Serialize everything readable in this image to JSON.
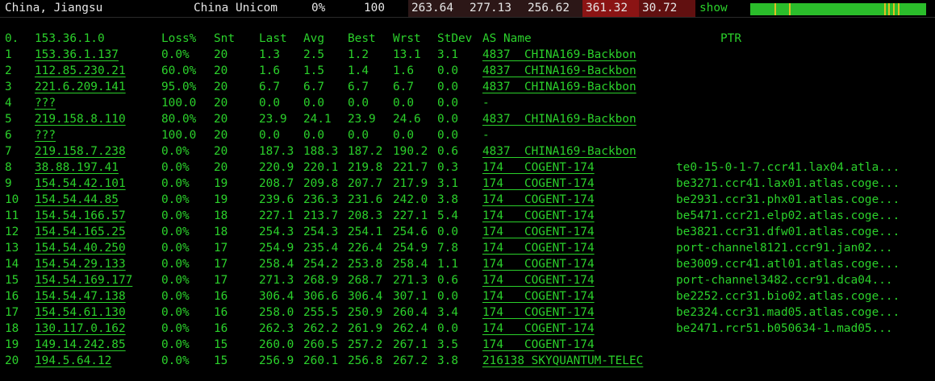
{
  "summary": {
    "location": "China, Jiangsu",
    "isp": "China Unicom",
    "loss": "0%",
    "sent": "100",
    "last": "263.64",
    "avg": "277.13",
    "best": "256.62",
    "worst": "361.32",
    "stdev": "30.72",
    "show_label": "show",
    "colors": {
      "last_bg": "#2c1717",
      "avg_bg": "#2c1717",
      "best_bg": "#2c1717",
      "worst_bg": "#8b1414",
      "stdev_bg": "#611010",
      "spark": "#2bbd2b",
      "spark_tick": "#e0c020"
    }
  },
  "table": {
    "headers": {
      "hop": "0.",
      "ip": "153.36.1.0",
      "loss": "Loss%",
      "snt": "Snt",
      "last": "Last",
      "avg": "Avg",
      "best": "Best",
      "wrst": "Wrst",
      "stdev": "StDev",
      "as": "AS Name",
      "ptr": "PTR"
    },
    "rows": [
      {
        "hop": "1",
        "ip": "153.36.1.137",
        "loss": "0.0%",
        "snt": "20",
        "last": "1.3",
        "avg": "2.5",
        "best": "1.2",
        "wrst": "13.1",
        "stdev": "3.1",
        "as": "4837  CHINA169-Backbon",
        "ptr": ""
      },
      {
        "hop": "2",
        "ip": "112.85.230.21",
        "loss": "60.0%",
        "snt": "20",
        "last": "1.6",
        "avg": "1.5",
        "best": "1.4",
        "wrst": "1.6",
        "stdev": "0.0",
        "as": "4837  CHINA169-Backbon",
        "ptr": ""
      },
      {
        "hop": "3",
        "ip": "221.6.209.141",
        "loss": "95.0%",
        "snt": "20",
        "last": "6.7",
        "avg": "6.7",
        "best": "6.7",
        "wrst": "6.7",
        "stdev": "0.0",
        "as": "4837  CHINA169-Backbon",
        "ptr": ""
      },
      {
        "hop": "4",
        "ip": "???",
        "loss": "100.0",
        "snt": "20",
        "last": "0.0",
        "avg": "0.0",
        "best": "0.0",
        "wrst": "0.0",
        "stdev": "0.0",
        "as": "-",
        "ptr": ""
      },
      {
        "hop": "5",
        "ip": "219.158.8.110",
        "loss": "80.0%",
        "snt": "20",
        "last": "23.9",
        "avg": "24.1",
        "best": "23.9",
        "wrst": "24.6",
        "stdev": "0.0",
        "as": "4837  CHINA169-Backbon",
        "ptr": ""
      },
      {
        "hop": "6",
        "ip": "???",
        "loss": "100.0",
        "snt": "20",
        "last": "0.0",
        "avg": "0.0",
        "best": "0.0",
        "wrst": "0.0",
        "stdev": "0.0",
        "as": "-",
        "ptr": ""
      },
      {
        "hop": "7",
        "ip": "219.158.7.238",
        "loss": "0.0%",
        "snt": "20",
        "last": "187.3",
        "avg": "188.3",
        "best": "187.2",
        "wrst": "190.2",
        "stdev": "0.6",
        "as": "4837  CHINA169-Backbon",
        "ptr": ""
      },
      {
        "hop": "8",
        "ip": "38.88.197.41",
        "loss": "0.0%",
        "snt": "20",
        "last": "220.9",
        "avg": "220.1",
        "best": "219.8",
        "wrst": "221.7",
        "stdev": "0.3",
        "as": "174   COGENT-174",
        "ptr": "te0-15-0-1-7.ccr41.lax04.atla..."
      },
      {
        "hop": "9",
        "ip": "154.54.42.101",
        "loss": "0.0%",
        "snt": "19",
        "last": "208.7",
        "avg": "209.8",
        "best": "207.7",
        "wrst": "217.9",
        "stdev": "3.1",
        "as": "174   COGENT-174",
        "ptr": "be3271.ccr41.lax01.atlas.coge..."
      },
      {
        "hop": "10",
        "ip": "154.54.44.85",
        "loss": "0.0%",
        "snt": "19",
        "last": "239.6",
        "avg": "236.3",
        "best": "231.6",
        "wrst": "242.0",
        "stdev": "3.8",
        "as": "174   COGENT-174",
        "ptr": "be2931.ccr31.phx01.atlas.coge..."
      },
      {
        "hop": "11",
        "ip": "154.54.166.57",
        "loss": "0.0%",
        "snt": "18",
        "last": "227.1",
        "avg": "213.7",
        "best": "208.3",
        "wrst": "227.1",
        "stdev": "5.4",
        "as": "174   COGENT-174",
        "ptr": "be5471.ccr21.elp02.atlas.coge..."
      },
      {
        "hop": "12",
        "ip": "154.54.165.25",
        "loss": "0.0%",
        "snt": "18",
        "last": "254.3",
        "avg": "254.3",
        "best": "254.1",
        "wrst": "254.6",
        "stdev": "0.0",
        "as": "174   COGENT-174",
        "ptr": "be3821.ccr31.dfw01.atlas.coge..."
      },
      {
        "hop": "13",
        "ip": "154.54.40.250",
        "loss": "0.0%",
        "snt": "17",
        "last": "254.9",
        "avg": "235.4",
        "best": "226.4",
        "wrst": "254.9",
        "stdev": "7.8",
        "as": "174   COGENT-174",
        "ptr": "port-channel8121.ccr91.jan02..."
      },
      {
        "hop": "14",
        "ip": "154.54.29.133",
        "loss": "0.0%",
        "snt": "17",
        "last": "258.4",
        "avg": "254.2",
        "best": "253.8",
        "wrst": "258.4",
        "stdev": "1.1",
        "as": "174   COGENT-174",
        "ptr": "be3009.ccr41.atl01.atlas.coge..."
      },
      {
        "hop": "15",
        "ip": "154.54.169.177",
        "loss": "0.0%",
        "snt": "17",
        "last": "271.3",
        "avg": "268.9",
        "best": "268.7",
        "wrst": "271.3",
        "stdev": "0.6",
        "as": "174   COGENT-174",
        "ptr": "port-channel3482.ccr91.dca04..."
      },
      {
        "hop": "16",
        "ip": "154.54.47.138",
        "loss": "0.0%",
        "snt": "16",
        "last": "306.4",
        "avg": "306.6",
        "best": "306.4",
        "wrst": "307.1",
        "stdev": "0.0",
        "as": "174   COGENT-174",
        "ptr": "be2252.ccr31.bio02.atlas.coge..."
      },
      {
        "hop": "17",
        "ip": "154.54.61.130",
        "loss": "0.0%",
        "snt": "16",
        "last": "258.0",
        "avg": "255.5",
        "best": "250.9",
        "wrst": "260.4",
        "stdev": "3.4",
        "as": "174   COGENT-174",
        "ptr": "be2324.ccr31.mad05.atlas.coge..."
      },
      {
        "hop": "18",
        "ip": "130.117.0.162",
        "loss": "0.0%",
        "snt": "16",
        "last": "262.3",
        "avg": "262.2",
        "best": "261.9",
        "wrst": "262.4",
        "stdev": "0.0",
        "as": "174   COGENT-174",
        "ptr": "be2471.rcr51.b050634-1.mad05..."
      },
      {
        "hop": "19",
        "ip": "149.14.242.85",
        "loss": "0.0%",
        "snt": "15",
        "last": "260.0",
        "avg": "260.5",
        "best": "257.2",
        "wrst": "267.1",
        "stdev": "3.5",
        "as": "174   COGENT-174",
        "ptr": ""
      },
      {
        "hop": "20",
        "ip": "194.5.64.12",
        "loss": "0.0%",
        "snt": "15",
        "last": "256.9",
        "avg": "260.1",
        "best": "256.8",
        "wrst": "267.2",
        "stdev": "3.8",
        "as": "216138 SKYQUANTUM-TELEC",
        "ptr": ""
      }
    ]
  }
}
